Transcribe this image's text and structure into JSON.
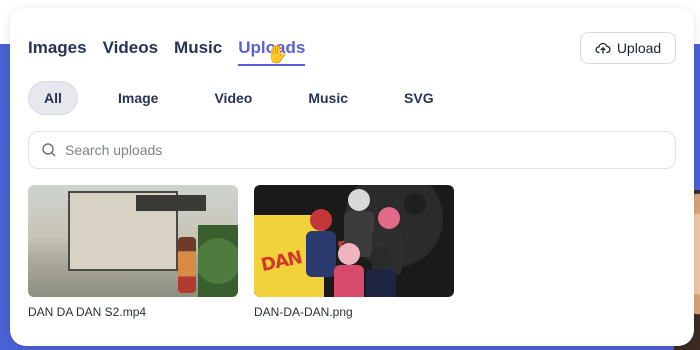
{
  "tabs": [
    "Images",
    "Videos",
    "Music",
    "Uploads"
  ],
  "active_tab_index": 3,
  "upload_button_label": "Upload",
  "filters": [
    "All",
    "Image",
    "Video",
    "Music",
    "SVG"
  ],
  "active_filter_index": 0,
  "search": {
    "placeholder": "Search uploads",
    "value": ""
  },
  "uploads": [
    {
      "filename": "DAN DA DAN S2.mp4",
      "type": "video"
    },
    {
      "filename": "DAN-DA-DAN.png",
      "type": "image",
      "logo_text": "DAN DA DAN"
    }
  ],
  "colors": {
    "accent": "#5b5fd6",
    "background_band": "#4a63d4"
  },
  "icons": {
    "upload": "cloud-upload-icon",
    "search": "search-icon",
    "cursor": "hand-cursor-icon"
  }
}
